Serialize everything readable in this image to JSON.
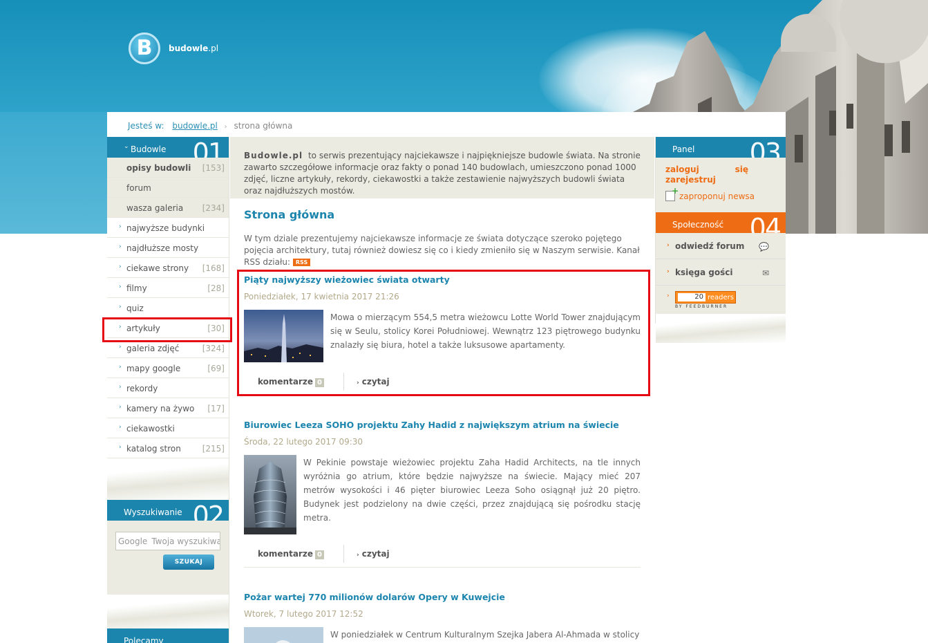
{
  "site": {
    "logo_letter": "B",
    "logo_name_bold": "budowle",
    "logo_name_tld": ".pl"
  },
  "breadcrumb": {
    "prefix": "Jesteś w:",
    "home": "budowle.pl",
    "separator": "›",
    "current": "strona główna"
  },
  "left": {
    "box1": {
      "title": "Budowle",
      "number": "01"
    },
    "nav": [
      {
        "label": "opisy budowli",
        "count": "[153]"
      },
      {
        "label": "forum",
        "count": ""
      },
      {
        "label": "wasza galeria",
        "count": "[234]"
      },
      {
        "label": "najwyższe budynki",
        "count": ""
      },
      {
        "label": "najdłuższe mosty",
        "count": ""
      },
      {
        "label": "ciekawe strony",
        "count": "[168]"
      },
      {
        "label": "filmy",
        "count": "[28]"
      },
      {
        "label": "quiz",
        "count": ""
      },
      {
        "label": "artykuły",
        "count": "[30]"
      },
      {
        "label": "galeria zdjęć",
        "count": "[324]"
      },
      {
        "label": "mapy google",
        "count": "[69]"
      },
      {
        "label": "rekordy",
        "count": ""
      },
      {
        "label": "kamery na żywo",
        "count": "[17]"
      },
      {
        "label": "ciekawostki",
        "count": ""
      },
      {
        "label": "katalog stron",
        "count": "[215]"
      }
    ],
    "box2": {
      "title": "Wyszukiwanie",
      "number": "02"
    },
    "search": {
      "google_label": "Google",
      "placeholder": "Twoja wyszukiwa",
      "button": "SZUKAJ"
    },
    "box3": {
      "title": "Polecamy"
    }
  },
  "center": {
    "intro_bold": "Budowle.pl",
    "intro_text": "to serwis prezentujący najciekawsze i najpiękniejsze budowle świata. Na stronie zawarto szczegółowe informacje oraz fakty o ponad 140 budowlach, umieszczono ponad 1000 zdjęć, liczne artykuły, rekordy, ciekawostki a także zestawienie najwyższych budowli świata oraz najdłuższych mostów.",
    "page_title": "Strona główna",
    "page_desc": "W tym dziale prezentujemy najciekawsze informacje ze świata dotyczące szeroko pojętego pojęcia architektury, tutaj również dowiesz się co i kiedy zmieniło się w Naszym serwisie. Kanał RSS działu:",
    "rss_label": "RSS",
    "articles": [
      {
        "title": "Piąty najwyższy wieżowiec świata otwarty",
        "date": "Poniedziałek, 17 kwietnia 2017 21:26",
        "text": "Mowa o mierzącym 554,5 metra wieżowcu Lotte World Tower znajdującym się w Seulu, stolicy Korei Południowej. Wewnątrz 123 piętrowego budynku znalazły się biura, hotel a także luksusowe apartamenty.",
        "comments_label": "komentarze",
        "comments_count": "0",
        "read_label": "czytaj"
      },
      {
        "title": "Biurowiec Leeza SOHO projektu Zahy Hadid z największym atrium na świecie",
        "date": "Środa, 22 lutego 2017 09:30",
        "text": "W Pekinie powstaje wieżowiec projektu Zaha Hadid Architects, na tle innych wyróżnia go atrium, które będzie najwyższe na świecie. Mający mieć 207 metrów wysokości i 46 pięter biurowiec Leeza Soho osiągnął już 20 piętro. Budynek jest podzielony na dwie części, przez znajdującą się pośrodku stację metra.",
        "comments_label": "komentarze",
        "comments_count": "0",
        "read_label": "czytaj"
      },
      {
        "title": "Pożar wartej 770 milionów dolarów Opery w Kuwejcie",
        "date": "Wtorek, 7 lutego 2017 12:52",
        "text": "W poniedziałek w Centrum Kulturalnym Szejka Jabera Al-Ahmada w stolicy"
      }
    ]
  },
  "right": {
    "box3": {
      "title": "Panel",
      "number": "03"
    },
    "login": "zaloguj",
    "login2": "się",
    "register": "zarejestruj",
    "propose": "zaproponuj newsa",
    "box4": {
      "title": "Społeczność",
      "number": "04"
    },
    "social": [
      {
        "label": "odwiedź forum",
        "icon": "chat-icon"
      },
      {
        "label": "księga gości",
        "icon": "envelope-icon"
      }
    ],
    "feed": {
      "count": "20",
      "readers": "readers",
      "by": "BY FEEDBURNER"
    }
  },
  "colors": {
    "blue": "#1c85ae",
    "orange": "#ee6c14",
    "highlight": "#e50914"
  }
}
